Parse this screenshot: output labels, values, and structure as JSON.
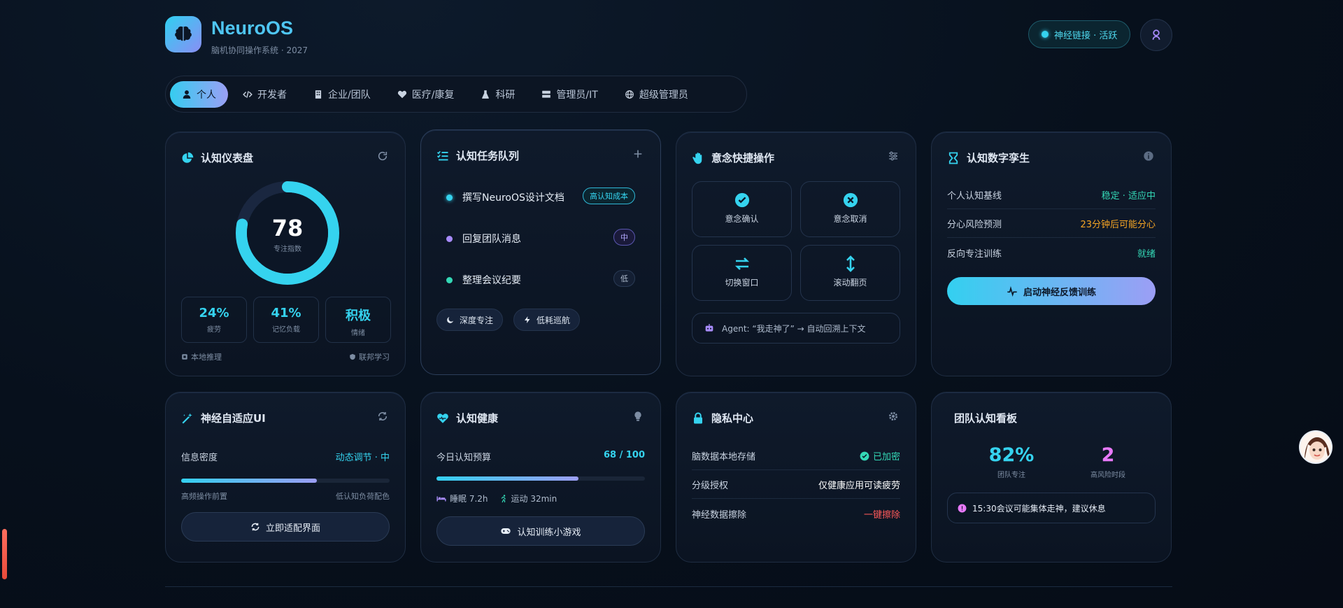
{
  "header": {
    "brand_title": "NeuroOS",
    "brand_subtitle": "脑机协同操作系统 · 2027",
    "status_label": "神经链接 · 活跃"
  },
  "tabs": [
    {
      "label": "个人",
      "icon": "user-icon",
      "active": true
    },
    {
      "label": "开发者",
      "icon": "code-icon"
    },
    {
      "label": "企业/团队",
      "icon": "building-icon"
    },
    {
      "label": "医疗/康复",
      "icon": "heart-pulse-icon"
    },
    {
      "label": "科研",
      "icon": "flask-icon"
    },
    {
      "label": "管理员/IT",
      "icon": "server-icon"
    },
    {
      "label": "超级管理员",
      "icon": "globe-icon"
    }
  ],
  "dashboard": {
    "title": "认知仪表盘",
    "focus_value": "78",
    "focus_label": "专注指数",
    "focus_fraction": 0.78,
    "stats": [
      {
        "value": "24%",
        "label": "疲劳"
      },
      {
        "value": "41%",
        "label": "记忆负载"
      },
      {
        "value": "积极",
        "label": "情绪"
      }
    ],
    "note_left": "本地推理",
    "note_right": "联邦学习"
  },
  "tasks": {
    "title": "认知任务队列",
    "items": [
      {
        "label": "撰写NeuroOS设计文档",
        "badge": "高认知成本",
        "dot": "#35d3ef"
      },
      {
        "label": "回复团队消息",
        "badge": "中",
        "dot": "#a78bfa"
      },
      {
        "label": "整理会议纪要",
        "badge": "低",
        "dot": "#34d8b6"
      }
    ],
    "chips": [
      "深度专注",
      "低耗巡航"
    ]
  },
  "intent": {
    "title": "意念快捷操作",
    "actions": [
      "意念确认",
      "意念取消",
      "切换窗口",
      "滚动翻页"
    ],
    "agent_text": "Agent: “我走神了” → 自动回溯上下文"
  },
  "twin": {
    "title": "认知数字孪生",
    "rows": [
      {
        "k": "个人认知基线",
        "v": "稳定 · 适应中",
        "color": "#34d8b6"
      },
      {
        "k": "分心风险预测",
        "v": "23分钟后可能分心",
        "color": "#f5a524"
      },
      {
        "k": "反向专注训练",
        "v": "就绪",
        "color": "#34d8b6"
      }
    ],
    "button": "启动神经反馈训练"
  },
  "adaptive": {
    "title": "神经自适应UI",
    "density_label": "信息密度",
    "density_value": "动态调节 · 中",
    "density_fraction": 0.65,
    "left_hint": "高频操作前置",
    "right_hint": "低认知负荷配色",
    "button": "立即适配界面"
  },
  "health": {
    "title": "认知健康",
    "budget_label": "今日认知预算",
    "budget_value": "68 / 100",
    "budget_fraction": 0.68,
    "sleep": "睡眠 7.2h",
    "exercise": "运动 32min",
    "button": "认知训练小游戏"
  },
  "privacy": {
    "title": "隐私中心",
    "rows": [
      {
        "k": "脑数据本地存储",
        "v": "已加密",
        "color": "#34d8b6"
      },
      {
        "k": "分级授权",
        "v": "仅健康应用可读疲劳",
        "color": "#ffffff"
      },
      {
        "k": "神经数据擦除",
        "v": "一键擦除",
        "color": "#ff5a5a"
      }
    ]
  },
  "team": {
    "title": "团队认知看板",
    "stats": [
      {
        "value": "82%",
        "label": "团队专注",
        "color": "#35d3ef"
      },
      {
        "value": "2",
        "label": "高风险时段",
        "color": "#e879f9"
      }
    ],
    "alert": "15:30会议可能集体走神，建议休息"
  },
  "colors": {
    "accent": "#35d3ef",
    "accent2": "#9c9ef5",
    "bg": "#07101c"
  }
}
